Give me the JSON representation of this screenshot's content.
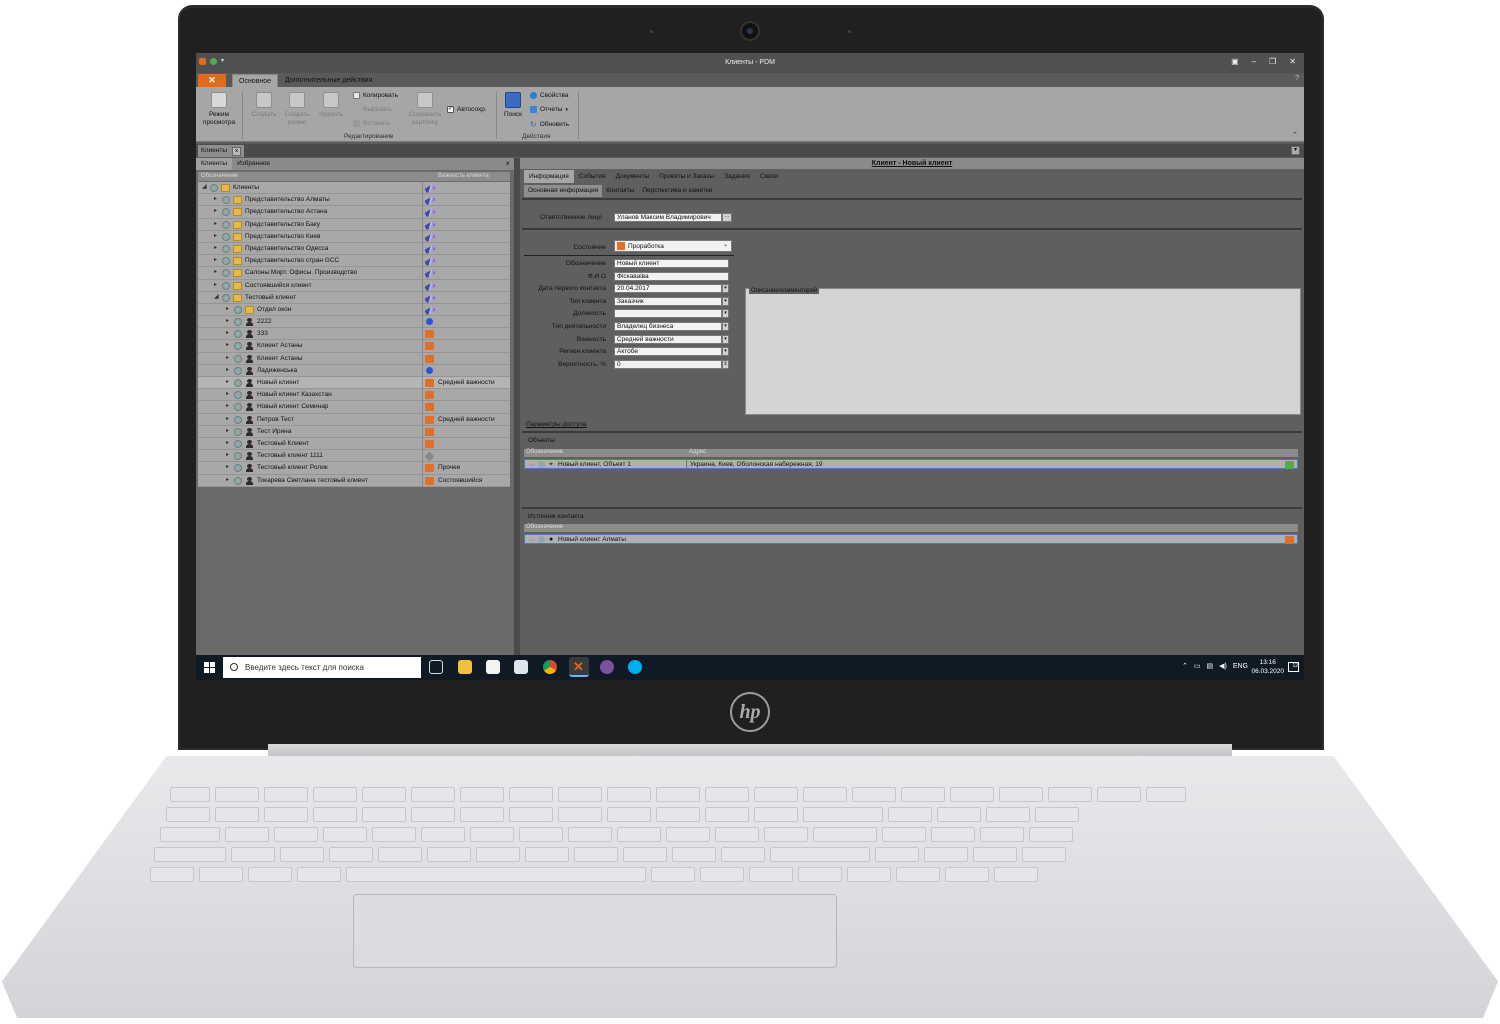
{
  "window": {
    "title": "Клиенты - PDM"
  },
  "ribbon": {
    "tabs": [
      "Основное",
      "Дополнительные действия"
    ],
    "buttons": {
      "view_mode": "Режим просмотра",
      "create": "Создать",
      "create_copy": "Создать копию",
      "delete": "Удалить",
      "copy": "Копировать",
      "cut": "Вырезать",
      "paste": "Вставить",
      "save_card": "Сохранить карточку",
      "autosave": "Автосохр.",
      "search": "Поиск",
      "properties": "Свойства",
      "reports": "Отчеты",
      "refresh": "Обновить"
    },
    "groups": {
      "edit": "Редактирование",
      "actions": "Действия"
    }
  },
  "doc_tab": "Клиенты",
  "left_pane": {
    "tabs": [
      "Клиенты",
      "Избранное"
    ],
    "columns": [
      "Обозначение",
      "Важность клиента"
    ],
    "rows": [
      {
        "label": "Клиенты",
        "icon": "folder-icon",
        "importance_icon": "pen-icon",
        "importance": ""
      },
      {
        "label": "Представительство Алматы",
        "icon": "folder-icon",
        "importance_icon": "pen-icon",
        "importance": ""
      },
      {
        "label": "Представительство Астана",
        "icon": "folder-icon",
        "importance_icon": "pen-icon",
        "importance": ""
      },
      {
        "label": "Представительство Баку",
        "icon": "folder-icon",
        "importance_icon": "pen-icon",
        "importance": ""
      },
      {
        "label": "Представительство Киев",
        "icon": "folder-icon",
        "importance_icon": "pen-icon",
        "importance": ""
      },
      {
        "label": "Представительство Одесса",
        "icon": "folder-icon",
        "importance_icon": "pen-icon",
        "importance": ""
      },
      {
        "label": "Представительство стран GCC",
        "icon": "folder-icon",
        "importance_icon": "pen-icon",
        "importance": ""
      },
      {
        "label": "Салоны Мирт. Офисы. Производство",
        "icon": "folder-icon",
        "importance_icon": "pen-icon",
        "importance": ""
      },
      {
        "label": "Состоявшийся клиент",
        "icon": "folder-icon",
        "importance_icon": "pen-icon",
        "importance": ""
      },
      {
        "label": "Тестовый клиент",
        "icon": "folder-icon",
        "importance_icon": "pen-icon",
        "importance": ""
      },
      {
        "label": "Отдел окон",
        "icon": "folder-icon",
        "importance_icon": "pen-icon",
        "importance": ""
      },
      {
        "label": "2222",
        "icon": "person-icon",
        "importance_icon": "blue-dot-icon",
        "importance": ""
      },
      {
        "label": "333",
        "icon": "person-icon",
        "importance_icon": "orange-flag-icon",
        "importance": ""
      },
      {
        "label": "Клиент Астаны",
        "icon": "person-icon",
        "importance_icon": "orange-flag-icon",
        "importance": ""
      },
      {
        "label": "Клиент Астаны",
        "icon": "person-icon",
        "importance_icon": "orange-flag-icon",
        "importance": ""
      },
      {
        "label": "Ладиженська",
        "icon": "person-icon",
        "importance_icon": "blue-dot-icon",
        "importance": ""
      },
      {
        "label": "Новый клиент",
        "icon": "person-icon",
        "importance_icon": "orange-flag-icon",
        "importance": "Средней важности"
      },
      {
        "label": "Новый клиент Казахстан",
        "icon": "person-icon",
        "importance_icon": "orange-flag-icon",
        "importance": ""
      },
      {
        "label": "Новый клиент Семинар",
        "icon": "person-icon",
        "importance_icon": "orange-flag-icon",
        "importance": ""
      },
      {
        "label": "Петров Тест",
        "icon": "person-icon",
        "importance_icon": "orange-flag-icon",
        "importance": "Средней важности"
      },
      {
        "label": "Тест Ирина",
        "icon": "person-icon",
        "importance_icon": "orange-flag-icon",
        "importance": ""
      },
      {
        "label": "Тестовый Клиент",
        "icon": "person-icon",
        "importance_icon": "orange-flag-icon",
        "importance": ""
      },
      {
        "label": "Тестовый клиент 1111",
        "icon": "person-icon",
        "importance_icon": "gray-diamond-icon",
        "importance": ""
      },
      {
        "label": "Тестовый клиент Ролик",
        "icon": "person-icon",
        "importance_icon": "orange-flag-icon",
        "importance": "Прочее"
      },
      {
        "label": "Токарева Светлана тестовый клиент",
        "icon": "person-icon",
        "importance_icon": "orange-flag-icon",
        "importance": "Состоявшийся"
      }
    ]
  },
  "card": {
    "header": "Клиент - Новый клиент",
    "tabs": [
      "Информация",
      "События",
      "Документы",
      "Проекты и Заказы",
      "Задания",
      "Связи"
    ],
    "subtabs": [
      "Основная информация",
      "Контакты",
      "Перспектива и заметки"
    ],
    "responsible_label": "Ответственное лицо",
    "responsible_value": "Уланов Максим Владимирович",
    "state_label": "Состояние",
    "state_value": "Проработка",
    "description_label": "Описание/комментарий",
    "fields": [
      {
        "label": "Обозначение",
        "value": "Новый клиент"
      },
      {
        "label": "Ф.И.О",
        "value": "Фіскаваіва"
      },
      {
        "label": "Дата первого контакта",
        "value": "20.04.2017"
      },
      {
        "label": "Тип клиента",
        "value": "Заказчик"
      },
      {
        "label": "Должность",
        "value": ""
      },
      {
        "label": "Тип деятельности",
        "value": "Владелец бизнеса"
      },
      {
        "label": "Важность",
        "value": "Средней важности"
      },
      {
        "label": "Регион клиента",
        "value": "Актобе"
      },
      {
        "label": "Вероятность, %",
        "value": "0"
      }
    ],
    "access_link": "Параметры доступа",
    "objects": {
      "title": "Объекты",
      "columns": [
        "Обозначение",
        "Адрес"
      ],
      "row": {
        "name": "Новый клиент, Объект 1",
        "address": "Украина, Киев, Оболонская набережная, 19"
      }
    },
    "source": {
      "title": "Источник контакта",
      "columns": [
        "Обозначение"
      ],
      "row": {
        "name": "Новый клиент Алматы"
      }
    }
  },
  "taskbar": {
    "search_placeholder": "Введите здесь текст для поиска",
    "lang": "ENG",
    "time": "13:16",
    "date": "06.03.2020",
    "notifications": "12"
  },
  "device": {
    "logo": "hp"
  },
  "colors": {
    "accent": "#e26a1c",
    "taskbar": "#0f1a25",
    "selection_border": "#4a7ab8"
  }
}
